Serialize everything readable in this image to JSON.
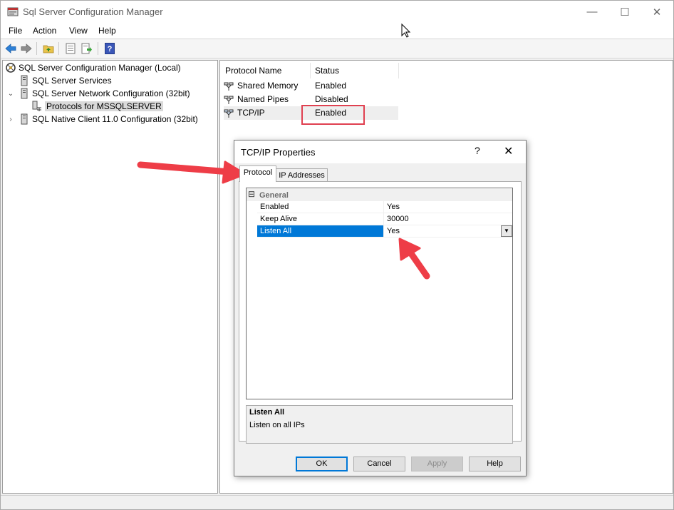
{
  "window": {
    "title": "Sql Server Configuration Manager",
    "controls": {
      "minimize": "—",
      "maximize": "☐",
      "close": "✕"
    }
  },
  "menu": [
    "File",
    "Action",
    "View",
    "Help"
  ],
  "toolbar": {
    "icons": [
      "back-arrow-icon",
      "forward-arrow-icon",
      "up-folder-icon",
      "properties-icon",
      "export-list-icon",
      "help-icon"
    ],
    "help_glyph": "?"
  },
  "tree": {
    "root": "SQL Server Configuration Manager (Local)",
    "services": "SQL Server Services",
    "network": "SQL Server Network Configuration (32bit)",
    "protocols": "Protocols for MSSQLSERVER",
    "native": "SQL Native Client 11.0 Configuration (32bit)",
    "expanded_glyph": "⌄",
    "collapsed_glyph": "›"
  },
  "list": {
    "headers": {
      "name": "Protocol Name",
      "status": "Status"
    },
    "rows": [
      {
        "name": "Shared Memory",
        "status": "Enabled"
      },
      {
        "name": "Named Pipes",
        "status": "Disabled"
      },
      {
        "name": "TCP/IP",
        "status": "Enabled"
      }
    ]
  },
  "dialog": {
    "title": "TCP/IP Properties",
    "help": "?",
    "close": "✕",
    "tabs": [
      "Protocol",
      "IP Addresses"
    ],
    "category": "General",
    "collapse_glyph": "⊟",
    "properties": [
      {
        "name": "Enabled",
        "value": "Yes"
      },
      {
        "name": "Keep Alive",
        "value": "30000"
      },
      {
        "name": "Listen All",
        "value": "Yes"
      }
    ],
    "dropdown_glyph": "▼",
    "description": {
      "title": "Listen All",
      "text": "Listen on all IPs"
    },
    "buttons": {
      "ok": "OK",
      "cancel": "Cancel",
      "apply": "Apply",
      "help": "Help"
    }
  },
  "colors": {
    "annotation": "#ee3d47",
    "selection": "#0078d7"
  }
}
